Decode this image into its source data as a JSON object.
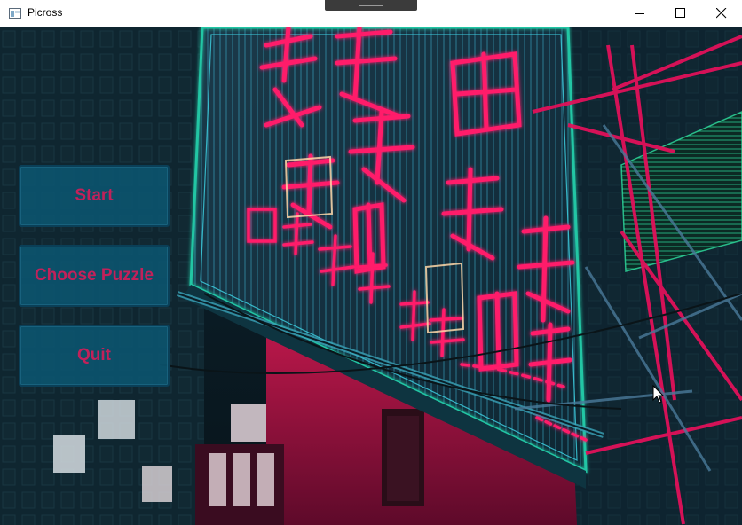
{
  "window": {
    "title": "Picross",
    "icon": "app-window-icon",
    "controls": [
      "minimize-icon",
      "maximize-icon",
      "close-icon"
    ]
  },
  "menu": {
    "start_label": "Start",
    "choose_puzzle_label": "Choose Puzzle",
    "quit_label": "Quit"
  },
  "colors": {
    "button_fill": "#0b5570",
    "button_border": "#0a3f57",
    "button_text": "#c2215a",
    "neon_pink": "#ff1a6b",
    "neon_teal": "#21c6a4"
  }
}
